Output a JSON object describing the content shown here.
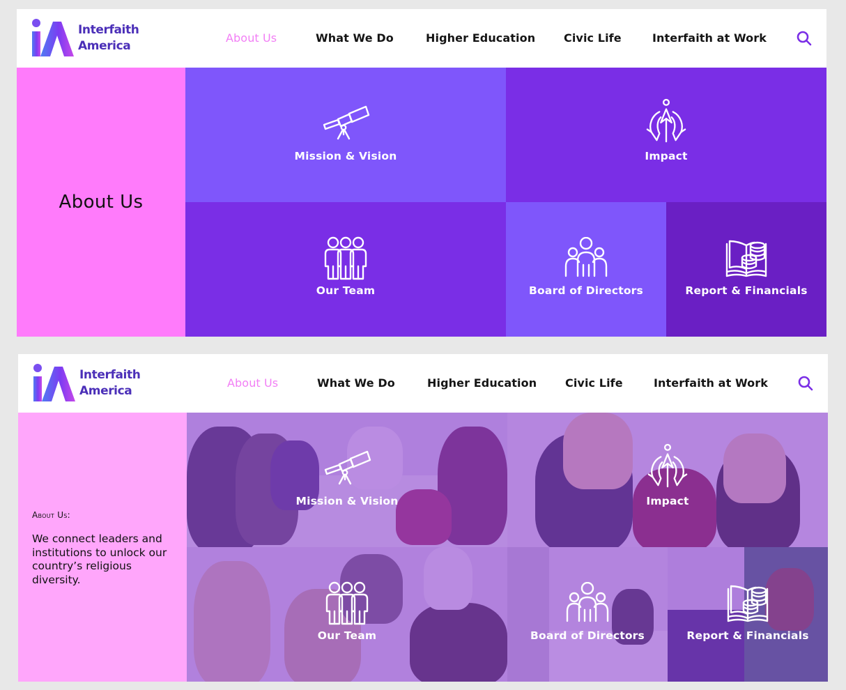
{
  "colors": {
    "brand": "#4b2fb8",
    "nav_active": "#f27ff5",
    "side_solid": "#ff7bfb",
    "side_light": "#ffa6fb",
    "tile_light": "#7f56fb",
    "tile_mid": "#7a2ee6",
    "tile_dark": "#6a1fc4",
    "search_icon": "#7a2ee6"
  },
  "logo": {
    "line1": "Interfaith",
    "line2": "America"
  },
  "nav": {
    "about": "About Us",
    "what": "What We Do",
    "higher": "Higher Education",
    "civic": "Civic Life",
    "work": "Interfaith at Work"
  },
  "panel1": {
    "side_title": "About Us"
  },
  "panel2": {
    "side_kicker": "About Us:",
    "side_desc": "We connect leaders and institutions to unlock our country’s religious diversity."
  },
  "tiles": {
    "mission": {
      "label": "Mission & Vision",
      "icon": "telescope-icon"
    },
    "impact": {
      "label": "Impact",
      "icon": "impact-arrows-icon"
    },
    "team": {
      "label": "Our Team",
      "icon": "team-icon"
    },
    "board": {
      "label": "Board of Directors",
      "icon": "group-icon"
    },
    "report": {
      "label": "Report & Financials",
      "icon": "book-coins-icon"
    }
  }
}
